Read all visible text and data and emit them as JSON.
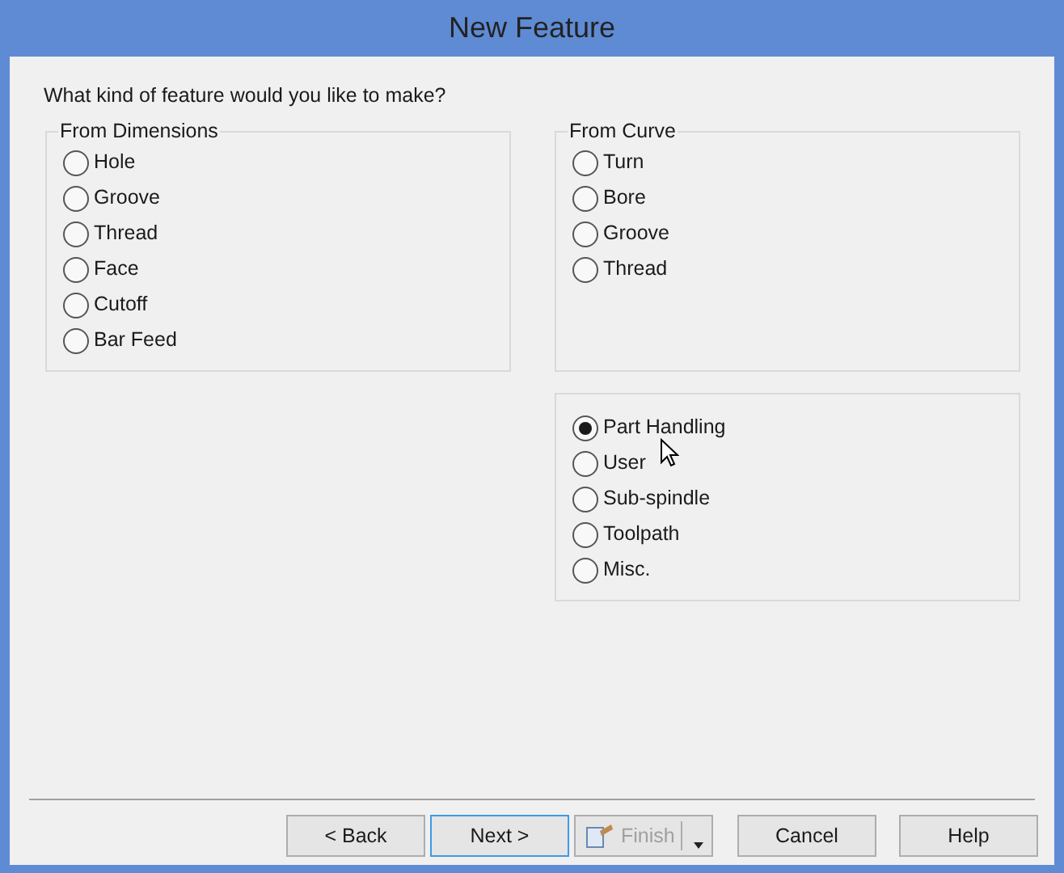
{
  "window": {
    "title": "New Feature"
  },
  "prompt": "What kind of feature would you like to make?",
  "groups": [
    {
      "title": "From Dimensions",
      "options": [
        {
          "label": "Hole",
          "selected": false
        },
        {
          "label": "Groove",
          "selected": false
        },
        {
          "label": "Thread",
          "selected": false
        },
        {
          "label": "Face",
          "selected": false
        },
        {
          "label": "Cutoff",
          "selected": false
        },
        {
          "label": "Bar Feed",
          "selected": false
        }
      ]
    },
    {
      "title": "From Curve",
      "options": [
        {
          "label": "Turn",
          "selected": false
        },
        {
          "label": "Bore",
          "selected": false
        },
        {
          "label": "Groove",
          "selected": false
        },
        {
          "label": "Thread",
          "selected": false
        }
      ]
    },
    {
      "options": [
        {
          "label": "Part Handling",
          "selected": true
        },
        {
          "label": "User",
          "selected": false
        },
        {
          "label": "Sub-spindle",
          "selected": false
        },
        {
          "label": "Toolpath",
          "selected": false
        },
        {
          "label": "Misc.",
          "selected": false
        }
      ]
    }
  ],
  "buttons": [
    {
      "label": "< Back",
      "kind": "plain",
      "focused": false,
      "disabled": false
    },
    {
      "label": "Next >",
      "kind": "plain",
      "focused": true,
      "disabled": false
    },
    {
      "label": "Finish",
      "kind": "split",
      "focused": false,
      "disabled": true
    },
    {
      "label": "Cancel",
      "kind": "plain",
      "focused": false,
      "disabled": false
    },
    {
      "label": "Help",
      "kind": "plain",
      "focused": false,
      "disabled": false
    }
  ]
}
